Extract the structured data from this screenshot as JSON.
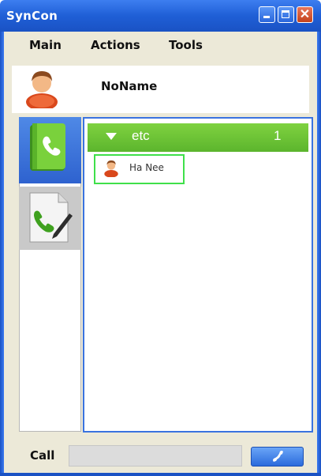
{
  "window": {
    "title": "SynCon",
    "close_glyph": "✕"
  },
  "menu": {
    "items": [
      "Main",
      "Actions",
      "Tools"
    ]
  },
  "profile": {
    "name": "NoName",
    "avatar_icon": "user-avatar-icon"
  },
  "tabs": [
    {
      "name": "contacts",
      "icon": "phone-book-icon",
      "active": true
    },
    {
      "name": "call-log",
      "icon": "phone-document-icon",
      "active": false
    }
  ],
  "group": {
    "name": "etc",
    "count": "1",
    "color": "#6cc535"
  },
  "contacts": [
    {
      "name": "Ha Nee",
      "icon": "user-avatar-icon",
      "selected": true
    }
  ],
  "call": {
    "label": "Call",
    "value": "",
    "button_icon": "phone-handset-icon"
  },
  "colors": {
    "titlebar": "#1f5fd6",
    "accent": "#3a73df",
    "selection": "#3fe04a"
  }
}
